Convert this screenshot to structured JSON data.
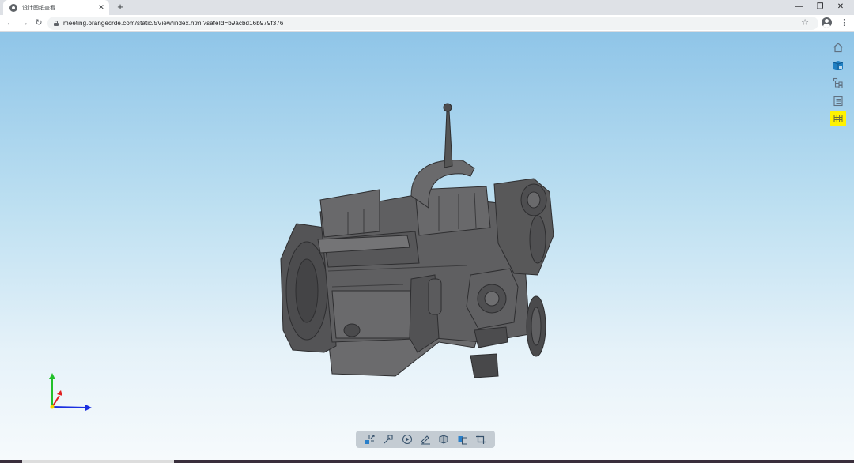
{
  "browser": {
    "tab": {
      "title": "设计图纸查看",
      "favicon": "globe-icon",
      "close": "✕"
    },
    "new_tab": "+",
    "window_controls": {
      "minimize": "—",
      "restore": "❐",
      "close": "✕"
    },
    "nav": {
      "back": "←",
      "forward": "→",
      "reload": "↻"
    },
    "url": "meeting.orangecrde.com/static/5View/index.html?safeId=b9acbd16b979f376",
    "bookmark": "☆",
    "menu": "⋮"
  },
  "viewer": {
    "right_toolbar": [
      {
        "name": "home-icon",
        "active": false
      },
      {
        "name": "view-cube-icon",
        "active": false
      },
      {
        "name": "model-tree-icon",
        "active": false
      },
      {
        "name": "properties-list-icon",
        "active": false
      },
      {
        "name": "grid-panel-icon",
        "active": true
      }
    ],
    "bottom_toolbar": [
      "explode-icon",
      "measure-icon",
      "play-icon",
      "markup-pen-icon",
      "section-cube-icon",
      "material-icon",
      "crop-icon"
    ],
    "colors": {
      "accent_active": "#fff200",
      "axis_x": "#1a2fe0",
      "axis_y": "#22c02a",
      "axis_z": "#e02020",
      "model": "#5d5d5f"
    }
  }
}
